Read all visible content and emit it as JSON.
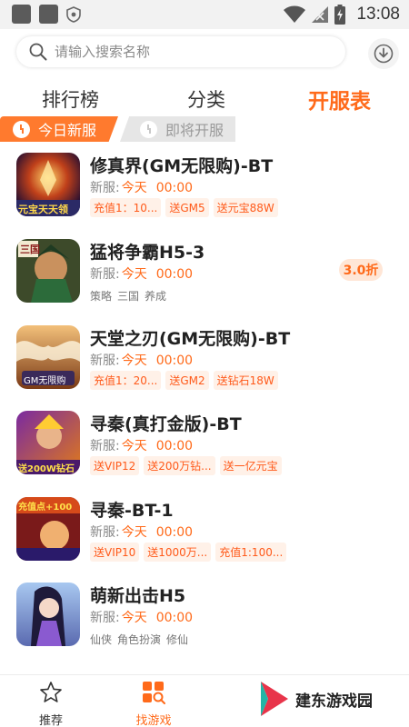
{
  "status_bar": {
    "time": "13:08"
  },
  "search": {
    "placeholder": "请输入搜索名称"
  },
  "tabs": [
    {
      "label": "排行榜",
      "active": false
    },
    {
      "label": "分类",
      "active": false
    },
    {
      "label": "开服表",
      "active": true
    }
  ],
  "sub_tabs": [
    {
      "label": "今日新服",
      "active": true
    },
    {
      "label": "即将开服",
      "active": false
    }
  ],
  "games": [
    {
      "name": "修真界(GM无限购)-BT",
      "open_prefix": "新服:",
      "open_day": "今天",
      "open_time": "00:00",
      "tags": [
        "充值1：10...",
        "送GM5",
        "送元宝88W"
      ],
      "tag_style": "benefit",
      "icon_text": "元宝天天领"
    },
    {
      "name": "猛将争霸H5-3",
      "open_prefix": "新服:",
      "open_day": "今天",
      "open_time": "00:00",
      "tags": [
        "策略",
        "三国",
        "养成"
      ],
      "tag_style": "plain",
      "discount": "3.0折",
      "icon_text": "三国"
    },
    {
      "name": "天堂之刃(GM无限购)-BT",
      "open_prefix": "新服:",
      "open_day": "今天",
      "open_time": "00:00",
      "tags": [
        "充值1：20...",
        "送GM2",
        "送钻石18W"
      ],
      "tag_style": "benefit",
      "icon_text": "GM无限购"
    },
    {
      "name": "寻秦(真打金版)-BT",
      "open_prefix": "新服:",
      "open_day": "今天",
      "open_time": "00:00",
      "tags": [
        "送VIP12",
        "送200万钻...",
        "送一亿元宝"
      ],
      "tag_style": "benefit",
      "icon_text": "送200W钻石"
    },
    {
      "name": "寻秦-BT-1",
      "open_prefix": "新服:",
      "open_day": "今天",
      "open_time": "00:00",
      "tags": [
        "送VIP10",
        "送1000万...",
        "充值1:100..."
      ],
      "tag_style": "benefit",
      "icon_text": "充值点+100"
    },
    {
      "name": "萌新出击H5",
      "open_prefix": "新服:",
      "open_day": "今天",
      "open_time": "00:00",
      "tags": [
        "仙侠",
        "角色扮演",
        "修仙"
      ],
      "tag_style": "plain",
      "icon_text": ""
    }
  ],
  "bottom_nav": [
    {
      "label": "推荐",
      "icon": "star-icon",
      "active": false
    },
    {
      "label": "找游戏",
      "icon": "grid-search-icon",
      "active": true
    }
  ],
  "watermark": {
    "text": "建东游戏园"
  },
  "colors": {
    "accent": "#ff6a1a",
    "subtab_active": "#ff7a2e",
    "tag_bg": "#fff1e8"
  }
}
